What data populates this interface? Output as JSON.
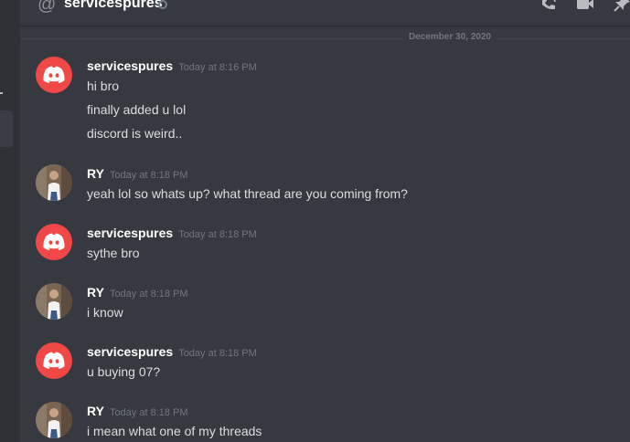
{
  "header": {
    "channel_name": "servicespures",
    "icons": [
      "at-icon",
      "phone-icon",
      "video-icon",
      "pin-icon"
    ]
  },
  "divider": {
    "date": "December 30, 2020"
  },
  "messages": [
    {
      "author": "servicespures",
      "avatar": "discord-logo-icon",
      "timestamp": "Today at 8:16 PM",
      "lines": [
        "hi bro",
        "finally added u lol",
        "discord is weird.."
      ]
    },
    {
      "author": "RY",
      "avatar": "user-photo",
      "timestamp": "Today at 8:18 PM",
      "lines": [
        "yeah lol so whats up? what thread are you coming from?"
      ]
    },
    {
      "author": "servicespures",
      "avatar": "discord-logo-icon",
      "timestamp": "Today at 8:18 PM",
      "lines": [
        "sythe bro"
      ]
    },
    {
      "author": "RY",
      "avatar": "user-photo",
      "timestamp": "Today at 8:18 PM",
      "lines": [
        "i know"
      ]
    },
    {
      "author": "servicespures",
      "avatar": "discord-logo-icon",
      "timestamp": "Today at 8:18 PM",
      "lines": [
        "u buying 07?"
      ]
    },
    {
      "author": "RY",
      "avatar": "user-photo",
      "timestamp": "Today at 8:18 PM",
      "lines": [
        "i mean what one of my threads"
      ]
    }
  ],
  "colors": {
    "background": "#36393f",
    "sidebar": "#2f3136",
    "discord_red": "#f04747",
    "username": "#ffffff",
    "text": "#dcddde",
    "muted": "#72767d"
  }
}
